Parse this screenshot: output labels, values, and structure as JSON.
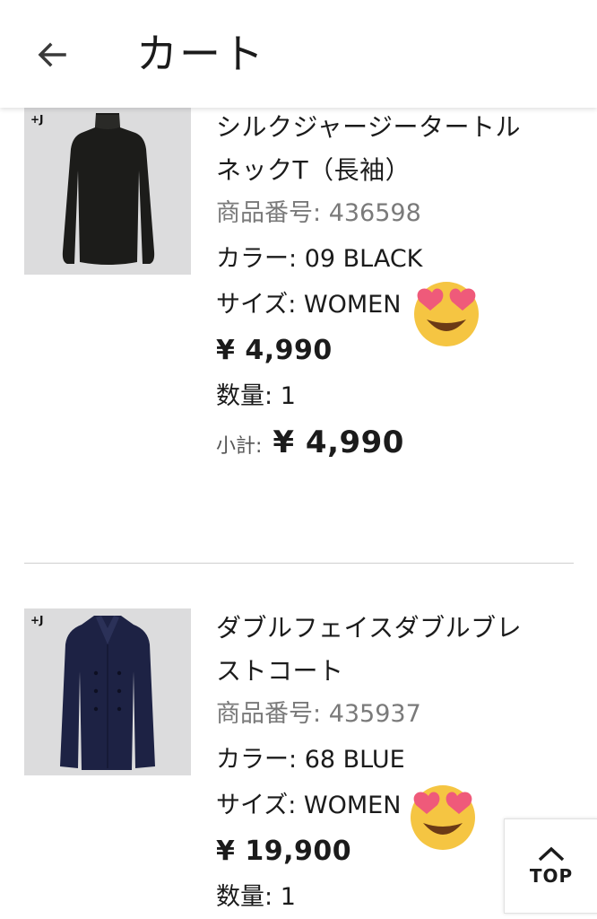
{
  "header": {
    "title": "カート",
    "back_icon": "arrow-left-icon"
  },
  "items": [
    {
      "name": "シルクジャージータートルネックT（長袖）",
      "name_line1": "シルクジャージータートル",
      "name_line2": "ネックT（長袖）",
      "brand_mark": "+J",
      "product_no_label": "商品番号:",
      "product_no": "436598",
      "color_label": "カラー:",
      "color": "09 BLACK",
      "size_label": "サイズ:",
      "size": "WOMEN",
      "price": "¥ 4,990",
      "qty_label": "数量:",
      "qty": "1",
      "subtotal_label": "小計:",
      "subtotal": "¥ 4,990",
      "image_color": "#1c1c1a",
      "emoji": "heart-eyes-emoji-icon"
    },
    {
      "name": "ダブルフェイスダブルブレストコート",
      "name_line1": "ダブルフェイスダブルブレ",
      "name_line2": "ストコート",
      "brand_mark": "+J",
      "product_no_label": "商品番号:",
      "product_no": "435937",
      "color_label": "カラー:",
      "color": "68 BLUE",
      "size_label": "サイズ:",
      "size": "WOMEN",
      "price": "¥ 19,900",
      "qty_label": "数量:",
      "qty": "1",
      "image_color": "#1d2244",
      "emoji": "heart-eyes-emoji-icon"
    }
  ],
  "top_button": {
    "label": "TOP",
    "icon": "chevron-up-icon"
  }
}
